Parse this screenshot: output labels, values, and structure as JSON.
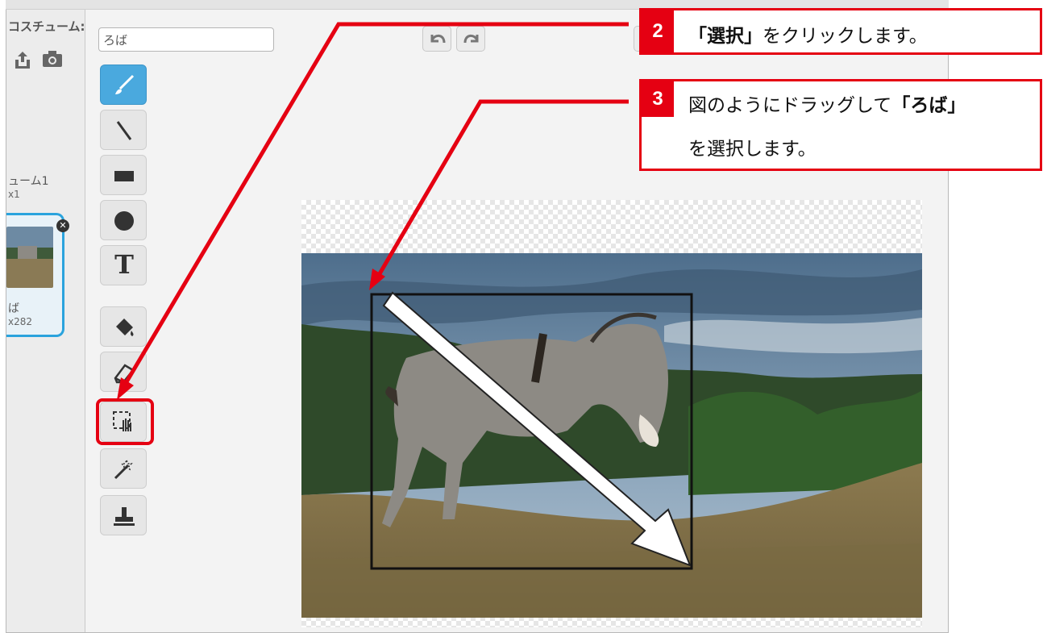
{
  "costume_panel": {
    "header_label": "コスチューム:",
    "name_value": "ろば",
    "costumes": [
      {
        "label": "ューム1",
        "size": "x1"
      },
      {
        "label": "ば",
        "size": "x282"
      }
    ]
  },
  "callouts": [
    {
      "number": "2",
      "line1_parts": [
        "「選択」",
        "をクリックします。"
      ]
    },
    {
      "number": "3",
      "line1_parts": [
        "図のようにドラッグして",
        "「ろば」"
      ],
      "line2": "を選択します。"
    }
  ],
  "tools": [
    {
      "name": "brush",
      "active": true
    },
    {
      "name": "line"
    },
    {
      "name": "rectangle"
    },
    {
      "name": "ellipse"
    },
    {
      "name": "text",
      "glyph": "T"
    },
    {
      "name": "fill"
    },
    {
      "name": "eraser"
    },
    {
      "name": "select",
      "highlighted": true
    },
    {
      "name": "select-remove-background"
    },
    {
      "name": "stamp"
    }
  ],
  "colors": {
    "accent_red": "#e50012",
    "tool_active_blue": "#4aa9de",
    "thumb_border": "#2aa3dd"
  }
}
